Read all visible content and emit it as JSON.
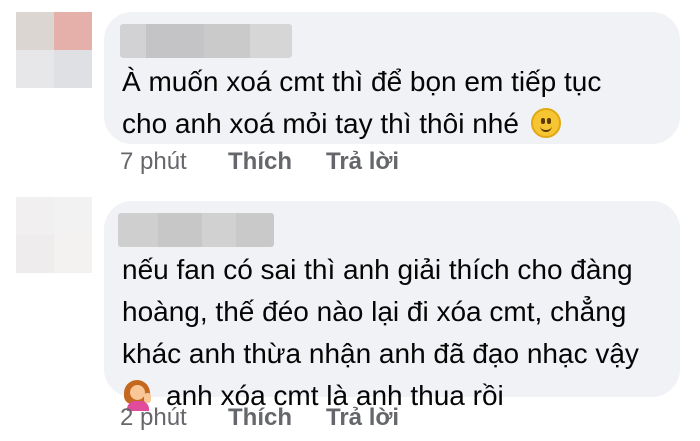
{
  "comments": [
    {
      "lines": [
        "À muốn xoá cmt thì để bọn em tiếp tục",
        "cho anh xoá mỏi tay thì thôi nhé"
      ],
      "trailing_emoji": "slightly-smiling-face-icon",
      "time": "7 phút",
      "like_label": "Thích",
      "reply_label": "Trả lời"
    },
    {
      "lines": [
        "nếu fan có sai thì anh giải thích cho đàng",
        "hoàng, thế đéo nào lại đi xóa cmt, chẳng",
        "khác anh thừa nhận anh đã đạo nhạc vậy",
        "anh xóa cmt là anh thua rồi"
      ],
      "leading_emoji_line4": "woman-tipping-hand-icon",
      "time": "2 phút",
      "like_label": "Thích",
      "reply_label": "Trả lời"
    }
  ],
  "colors": {
    "bubble": "#f0f2f5",
    "text": "#050505",
    "secondary_text": "#65676b"
  }
}
